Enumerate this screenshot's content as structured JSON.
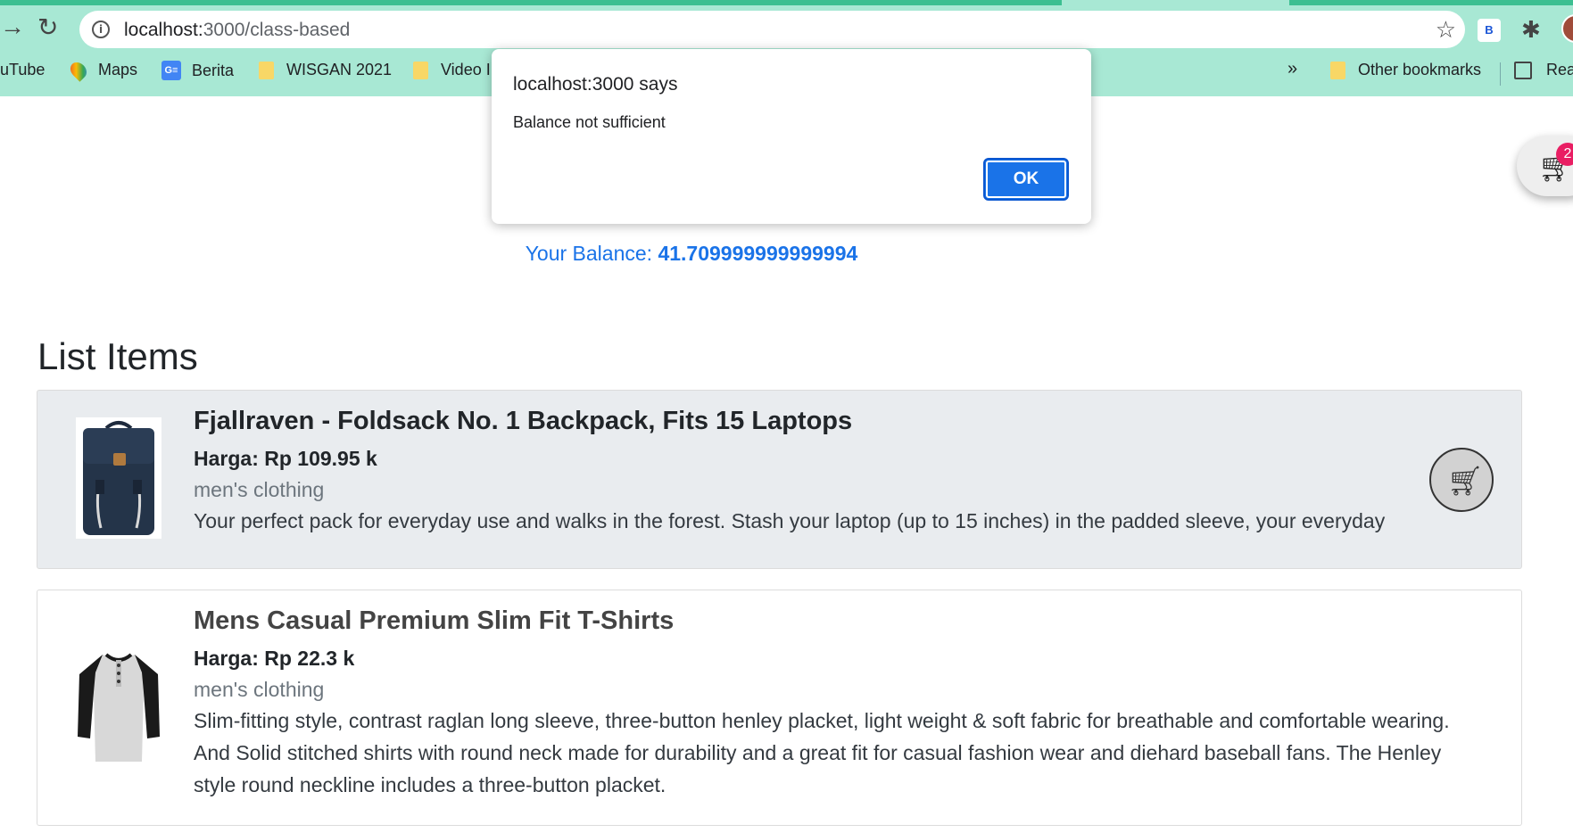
{
  "browser": {
    "url_host": "localhost:",
    "url_path": "3000/class-based",
    "extension_label": "B",
    "bookmarks": [
      {
        "label": "uTube",
        "icon": "youtube-icon"
      },
      {
        "label": "Maps",
        "icon": "maps-pin-icon"
      },
      {
        "label": "Berita",
        "icon": "google-news-icon"
      },
      {
        "label": "WISGAN 2021",
        "icon": "folder-icon"
      },
      {
        "label": "Video I",
        "icon": "folder-icon"
      }
    ],
    "overflow_label": "»",
    "other_bookmarks": "Other bookmarks",
    "reading_list": "Rea",
    "news_icon_text": "G≡"
  },
  "dialog": {
    "title": "localhost:3000 says",
    "message": "Balance not sufficient",
    "ok_label": "OK"
  },
  "cart": {
    "count": "2"
  },
  "balance": {
    "label": "Your Balance: ",
    "amount": "41.709999999999994"
  },
  "list": {
    "title": "List Items",
    "items": [
      {
        "name": "Fjallraven - Foldsack No. 1 Backpack, Fits 15 Laptops",
        "price": "Harga: Rp 109.95 k",
        "category": "men's clothing",
        "description": "Your perfect pack for everyday use and walks in the forest. Stash your laptop (up to 15 inches) in the padded sleeve, your everyday"
      },
      {
        "name": "Mens Casual Premium Slim Fit T-Shirts",
        "price": "Harga: Rp 22.3 k",
        "category": "men's clothing",
        "description": "Slim-fitting style, contrast raglan long sleeve, three-button henley placket, light weight & soft fabric for breathable and comfortable wearing. And Solid stitched shirts with round neck made for durability and a great fit for casual fashion wear and diehard baseball fans. The Henley style round neckline includes a three-button placket."
      }
    ]
  },
  "colors": {
    "accent": "#1a73e8",
    "chrome": "#a8e8d4",
    "badge": "#e91e63"
  }
}
